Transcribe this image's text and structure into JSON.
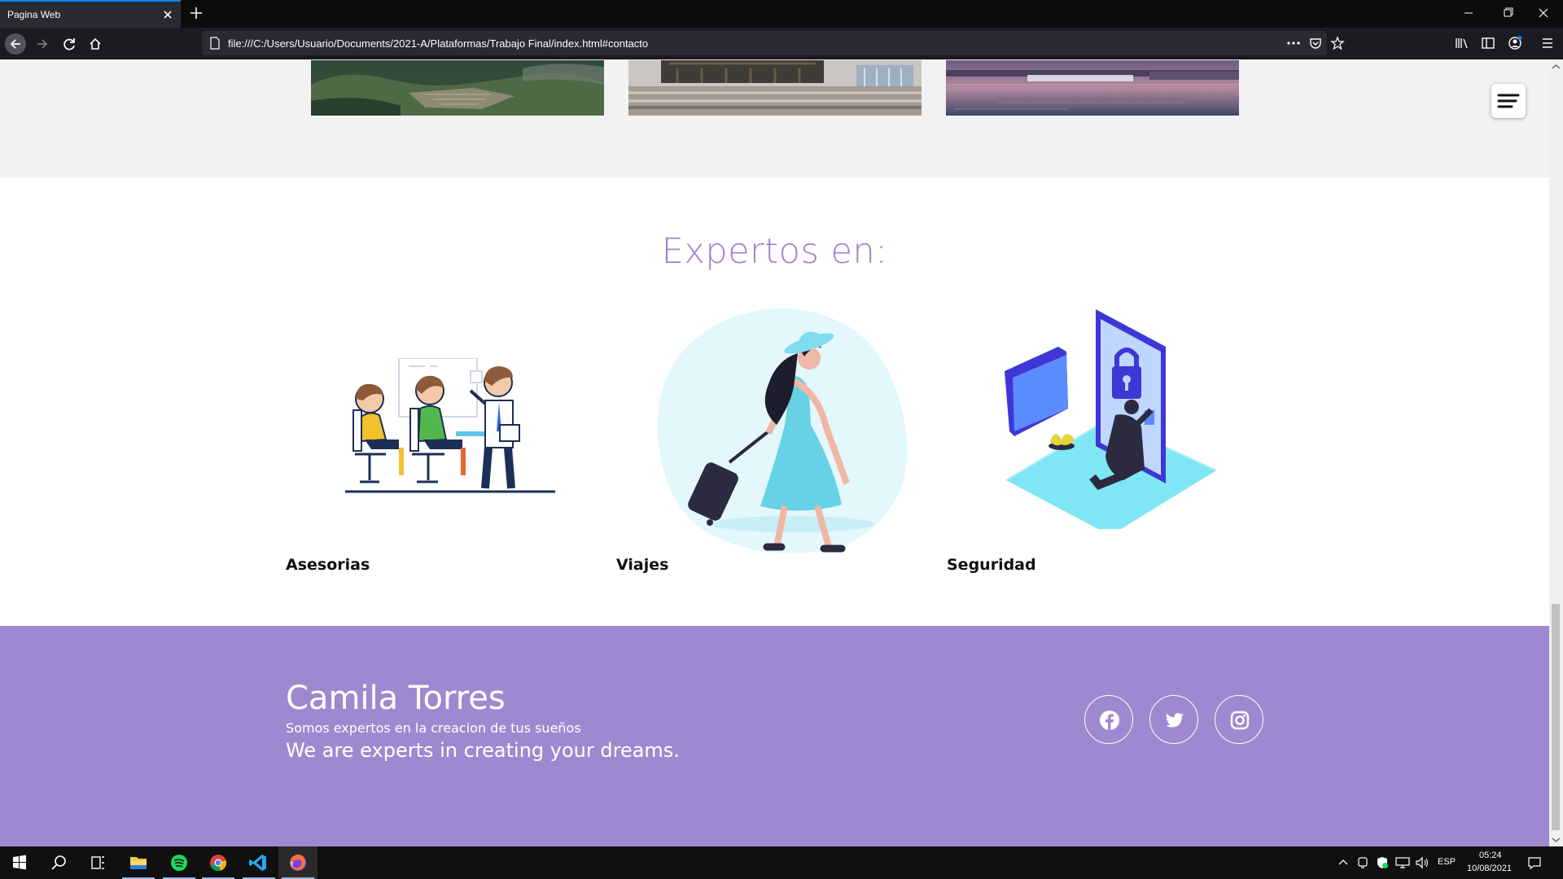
{
  "browser": {
    "tab_title": "Pagina Web",
    "url": "file:///C:/Users/Usuario/Documents/2021-A/Plataformas/Trabajo Final/index.html#contacto"
  },
  "page": {
    "section_title": "Expertos en:",
    "services": [
      {
        "label": "Asesorias",
        "icon": "meeting-illustration"
      },
      {
        "label": "Viajes",
        "icon": "traveler-illustration"
      },
      {
        "label": "Seguridad",
        "icon": "security-illustration"
      }
    ],
    "footer": {
      "name": "Camila Torres",
      "tagline_es": "Somos expertos en la creacion de tus sueños",
      "tagline_en": "We are experts in creating your dreams.",
      "social": [
        "facebook-icon",
        "twitter-icon",
        "instagram-icon"
      ]
    },
    "colors": {
      "accent": "#a07fd2",
      "footer_bg": "#a088d0"
    }
  },
  "taskbar": {
    "language": "ESP",
    "time": "05:24",
    "date": "10/08/2021"
  }
}
